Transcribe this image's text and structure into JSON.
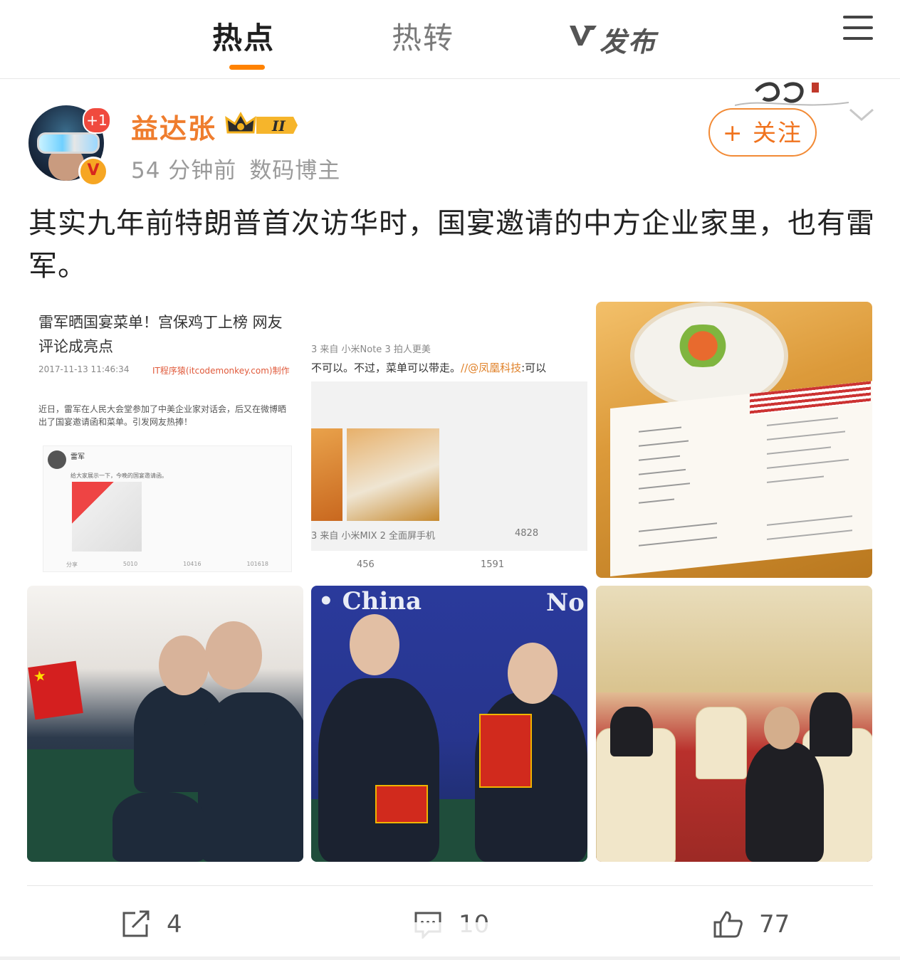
{
  "nav": {
    "tabs": [
      {
        "label": "热点",
        "active": true
      },
      {
        "label": "热转",
        "active": false
      },
      {
        "label": "发布",
        "active": false
      }
    ],
    "accent": "#ff8200"
  },
  "post": {
    "avatar_badge": "+1",
    "verified_badge": "V",
    "username": "益达张",
    "member_level": "II",
    "time": "54 分钟前",
    "category": "数码博主",
    "follow_label": "+ 关注",
    "text": "其实九年前特朗普首次访华时，国宴邀请的中方企业家里，也有雷军。",
    "name_color": "#ef7d2e"
  },
  "images": {
    "img1": {
      "headline": "雷军晒国宴菜单！宫保鸡丁上榜 网友评论成亮点",
      "date": "2017-11-13 11:46:34",
      "source": "IT程序猿(itcodemonkey.com)制作",
      "body": "近日，雷军在人民大会堂参加了中美企业家对话会，后又在微博晒出了国宴邀请函和菜单。引发网友热捧！",
      "embed_name": "雷军",
      "embed_text": "给大家展示一下，今晚的国宴邀请函。",
      "embed_actions": [
        "分享",
        "5010",
        "10416",
        "101618"
      ]
    },
    "img2": {
      "line1": "3 来自 小米Note 3 拍人更美",
      "line2_prefix": "不可以。不过，菜单可以带走。",
      "line2_mention": "//@凤凰科技",
      "line2_suffix": ":可以",
      "line3": "3 来自 小米MIX 2 全面屏手机",
      "line3_count": "4828",
      "repost_count": "456",
      "comment_count": "1591"
    },
    "img5": {
      "sign_left": "• China",
      "sign_right": "No"
    }
  },
  "actions": {
    "repost": "4",
    "comment": "10",
    "like": "77"
  }
}
